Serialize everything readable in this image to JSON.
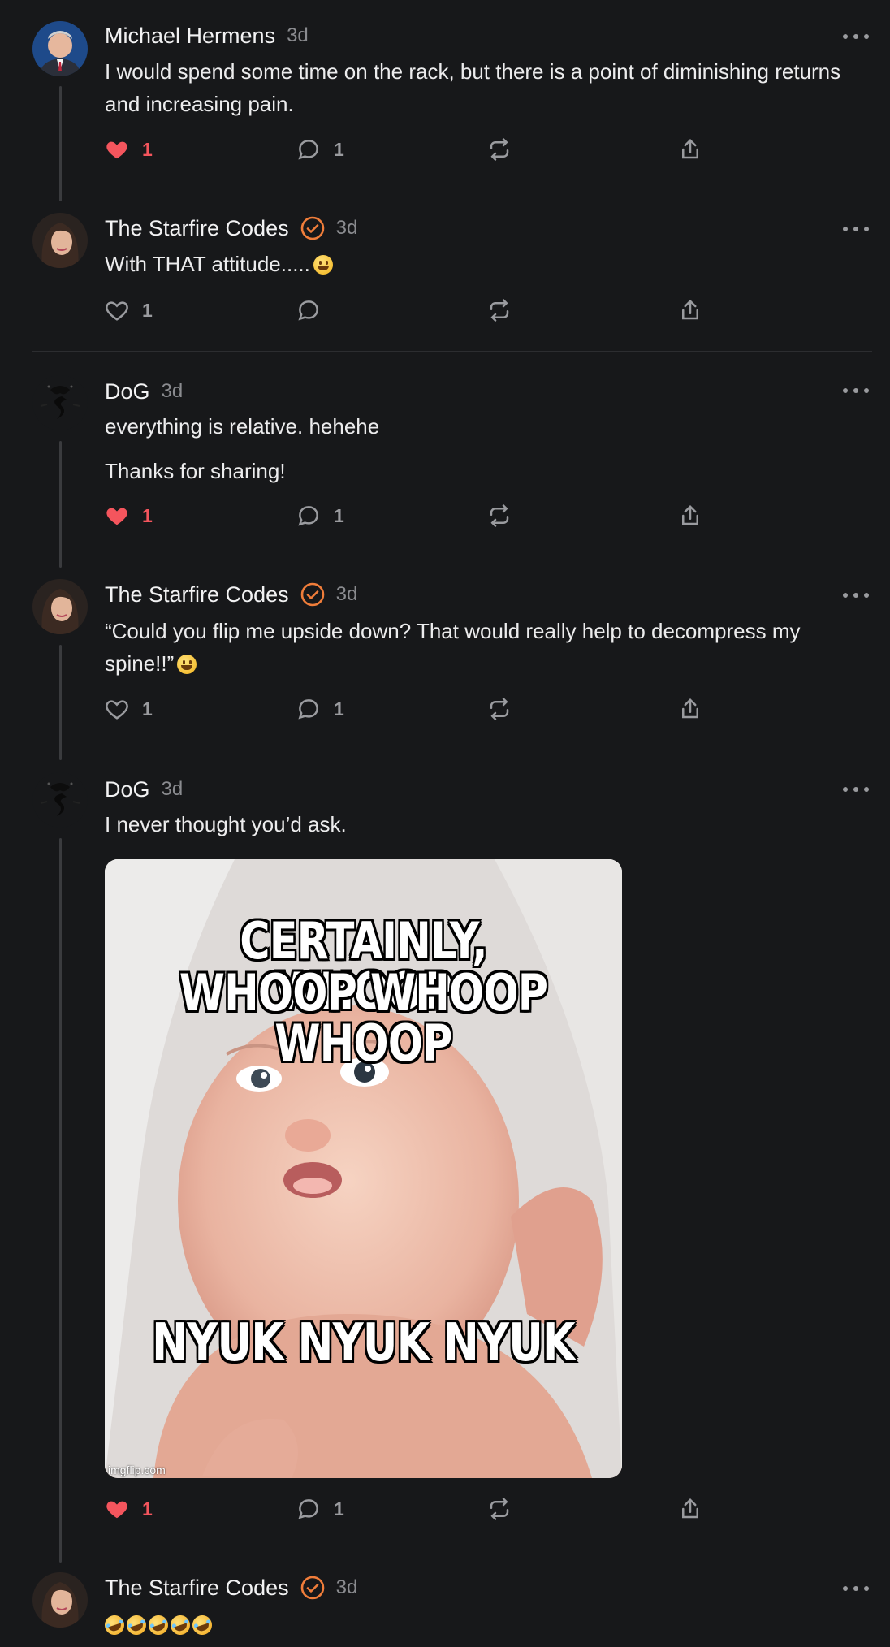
{
  "posts": [
    {
      "author": "Michael Hermens",
      "time": "3d",
      "text": "I would spend some time on the rack, but there is a point of diminishing returns and increasing pain.",
      "likes": "1",
      "comments": "1",
      "liked": true
    },
    {
      "author": "The Starfire Codes",
      "time": "3d",
      "text": "With THAT attitude.....",
      "likes": "1",
      "comments": "",
      "liked": false
    },
    {
      "author": "DoG",
      "time": "3d",
      "text": "everything is relative. hehehe",
      "text2": "Thanks for sharing!",
      "likes": "1",
      "comments": "1",
      "liked": true
    },
    {
      "author": "The Starfire Codes",
      "time": "3d",
      "text": "“Could you flip me upside down? That would really help to decompress my spine!!”",
      "likes": "1",
      "comments": "1",
      "liked": false
    },
    {
      "author": "DoG",
      "time": "3d",
      "text": "I never thought you’d ask.",
      "likes": "1",
      "comments": "1",
      "liked": true,
      "image": {
        "top_text_1": "CERTAINLY, WHOOP",
        "top_text_2": "WHOOP WHOOP WHOOP",
        "bottom_text": "NYUK NYUK NYUK",
        "watermark": "imgflip.com"
      }
    },
    {
      "author": "The Starfire Codes",
      "time": "3d",
      "text": ""
    }
  ],
  "colors": {
    "background": "#17181a",
    "like_active": "#f4555d",
    "verified": "#f07d3a",
    "muted": "#9a9b9f"
  },
  "icons": [
    "heart-icon",
    "comment-icon",
    "repost-icon",
    "share-icon",
    "verified-icon",
    "more-icon"
  ]
}
